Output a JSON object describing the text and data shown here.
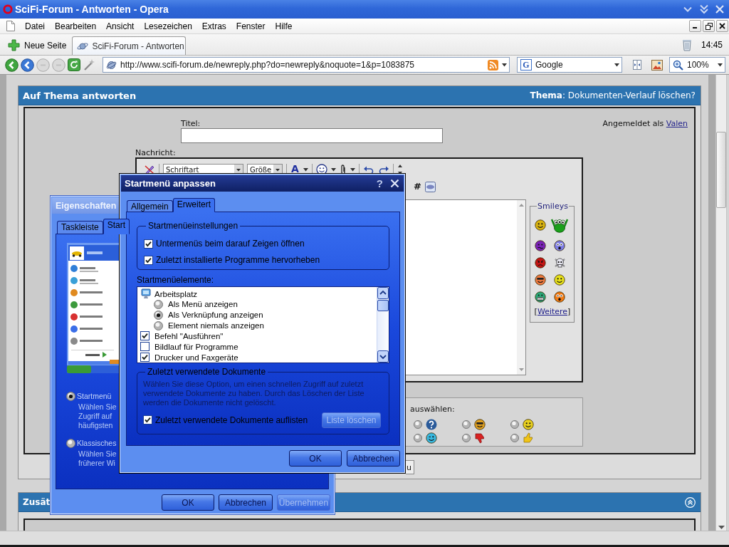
{
  "window": {
    "title": "SciFi-Forum - Antworten - Opera"
  },
  "menu": [
    "Datei",
    "Bearbeiten",
    "Ansicht",
    "Lesezeichen",
    "Extras",
    "Fenster",
    "Hilfe"
  ],
  "tab_bar": {
    "new_tab": "Neue Seite",
    "tabs": [
      {
        "label": "SciFi-Forum - Antworten",
        "selected": true
      }
    ],
    "clock": "14:45"
  },
  "address_bar": {
    "url": "http://www.scifi-forum.de/newreply.php?do=newreply&noquote=1&p=1083875",
    "search_logo": "G",
    "search_engine": "Google",
    "zoom": "100%"
  },
  "reply_panel": {
    "title": "Auf Thema antworten",
    "thread": "**Thema**: Dokumenten-Verlauf löschen?",
    "title_label": "Titel:",
    "logged_in": "Angemeldet als",
    "user": "Valen",
    "message_label": "Nachricht:",
    "editor": {
      "font": "Schriftart",
      "size": "Größe",
      "text_color": "A",
      "hash": "#",
      "smileys": {
        "title": "Smileys",
        "more_open": "[",
        "more": "Weitere",
        "more_close": "]"
      }
    },
    "post_icons": {
      "label": "auswählen:",
      "options": [
        {
          "selected": false
        },
        {
          "selected": false
        },
        {
          "selected": false
        },
        {
          "selected": false
        },
        {
          "selected": false
        },
        {
          "selected": false
        }
      ]
    },
    "cut_button": "u"
  },
  "options_panel": {
    "title": "Zusät"
  },
  "taskbar_dialog": {
    "title": "Eigenschaften",
    "active": false,
    "tabs": [
      {
        "label": "Taskleiste",
        "selected": false
      },
      {
        "label": "Start",
        "selected": true
      }
    ],
    "styles": [
      {
        "label": "Startmenü",
        "selected": true,
        "description": [
          "Wählen Sie",
          "Zugriff auf",
          "häufigsten"
        ]
      },
      {
        "label": "Klassisches",
        "selected": false,
        "description": [
          "Wählen Sie",
          "früherer Wi"
        ]
      }
    ],
    "buttons": [
      {
        "label": "OK",
        "disabled": false
      },
      {
        "label": "Abbrechen",
        "disabled": false
      },
      {
        "label": "Übernehmen",
        "disabled": true
      }
    ]
  },
  "start_menu_dialog": {
    "title": "Startmenü anpassen",
    "active": true,
    "help": "?",
    "tabs": [
      {
        "label": "Allgemein",
        "selected": false
      },
      {
        "label": "Erweitert",
        "selected": true
      }
    ],
    "settings": {
      "title": "Startmenüeinstellungen",
      "options": [
        {
          "label": "Untermenüs beim darauf Zeigen öffnen",
          "checked": true
        },
        {
          "label": "Zuletzt installierte Programme hervorheben",
          "checked": true
        }
      ]
    },
    "items_label": "Startmenüelemente:",
    "items": [
      {
        "kind": "heading",
        "label": "Arbeitsplatz"
      },
      {
        "kind": "radio",
        "label": "Als Menü anzeigen",
        "selected": false
      },
      {
        "kind": "radio",
        "label": "Als Verknüpfung anzeigen",
        "selected": true
      },
      {
        "kind": "radio",
        "label": "Element niemals anzeigen",
        "selected": false
      },
      {
        "kind": "checkbox",
        "label": "Befehl \"Ausführen\"",
        "checked": true
      },
      {
        "kind": "checkbox",
        "label": "Bildlauf für Programme",
        "checked": false
      },
      {
        "kind": "checkbox",
        "label": "Drucker und Faxgeräte",
        "checked": true
      }
    ],
    "recent": {
      "title": "Zuletzt verwendete Dokumente",
      "description": "Wählen Sie diese Option, um einen schnellen Zugriff auf zuletzt verwendete Dokumente zu haben. Durch das Löschen der Liste werden die Dokumente nicht gelöscht.",
      "option": {
        "label": "Zuletzt verwendete Dokumente auflisten",
        "checked": true
      },
      "clear_button": {
        "label": "Liste löschen",
        "disabled": true
      }
    },
    "buttons": [
      {
        "label": "OK",
        "disabled": false
      },
      {
        "label": "Abbrechen",
        "disabled": false
      }
    ]
  }
}
